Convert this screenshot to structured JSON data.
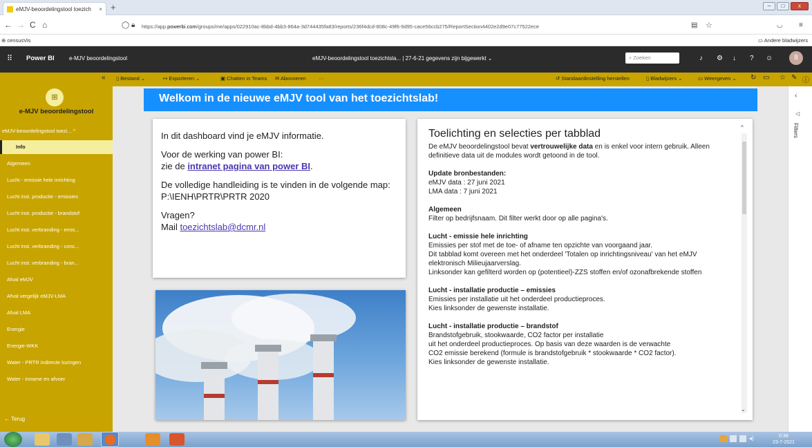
{
  "browser": {
    "tab_title": "eMJV-beoordelingstool toezich",
    "tab_close": "×",
    "new_tab": "+",
    "url_prefix": "https://app.",
    "url_domain": "powerbi.com",
    "url_rest": "/groups/me/apps/022910ac-8bbd-4bb3-864a-3d744435fa83/reports/236f4dcd-808c-49f6-9d95-cace56ccb275/ReportSection4402e2d9e07c77522ece",
    "bookmark": "censusVis",
    "other_bookmarks": "Andere bladwijzers"
  },
  "pbi": {
    "app_label": "Power BI",
    "app_name": "e-MJV beoordelingstool",
    "report_title": "eMJV-beoordelingstool toezichtsla...  |  27-6-21 gegevens zijn bijgewerkt",
    "search_placeholder": "Zoeken",
    "avatar_letter": "8"
  },
  "toolbar": {
    "file": "Bestand",
    "export": "Exporteren",
    "chat": "Chatten in Teams",
    "subscribe": "Abonneren",
    "more": "···",
    "reset": "Standaardinstelling herstellen",
    "bookmarks": "Bladwijzers",
    "view": "Weergeven"
  },
  "sidebar": {
    "app_title": "e-MJV beoordelingstool",
    "section": "eMJV-beoordelingstool toezi...",
    "back": "Terug",
    "items": [
      {
        "label": "Info",
        "selected": true
      },
      {
        "label": "Algemeen"
      },
      {
        "label": "Lucht - emissie hele inrichting"
      },
      {
        "label": "Lucht inst. productie - emissies"
      },
      {
        "label": "Lucht inst. productie - brandstof"
      },
      {
        "label": "Lucht inst. verbranding - emis..."
      },
      {
        "label": "Lucht inst. verbranding - conc..."
      },
      {
        "label": "Lucht inst. verbranding - bran..."
      },
      {
        "label": "Afval eMJV"
      },
      {
        "label": "Afval vergelijk eMJV-LMA"
      },
      {
        "label": "Afval LMA"
      },
      {
        "label": "Energie"
      },
      {
        "label": "Energie-WKK"
      },
      {
        "label": "Water - PRTR indirecte lozingen"
      },
      {
        "label": "Water - inname en afvoer"
      }
    ]
  },
  "report": {
    "banner": "Welkom in de nieuwe eMJV tool van het toezichtslab!",
    "info_intro": "In dit dashboard vind je eMJV informatie.",
    "info_power1": "Voor de werking van power BI:",
    "info_power2_pre": "zie de ",
    "info_power2_link": "intranet pagina van power BI",
    "info_power2_post": ".",
    "info_manual": "De volledige handleiding is te vinden in de volgende map: P:\\IENH\\PRTR\\PRTR 2020",
    "info_q": "Vragen?",
    "info_mail_pre": "Mail ",
    "info_mail_link": "toezichtslab@dcmr.nl",
    "right_title": "Toelichting en selecties per tabblad",
    "right_intro_pre": "De eMJV beoordelingstool bevat ",
    "right_intro_bold": "vertrouwelijke data",
    "right_intro_post": " en is enkel voor intern gebruik. Alleen definitieve data uit de modules wordt getoond in de tool.",
    "sections": [
      {
        "title": "Update bronbestanden:",
        "lines": [
          "eMJV data : 27 juni 2021",
          "LMA data  : 7 juni 2021"
        ]
      },
      {
        "title": "Algemeen",
        "lines": [
          "Filter op bedrijfsnaam. Dit filter werkt door op alle pagina's."
        ]
      },
      {
        "title": "Lucht - emissie hele inrichting",
        "lines": [
          "Emissies per stof met de toe- of afname ten opzichte van voorgaand jaar.",
          "Dit tabblad komt overeen met het onderdeel 'Totalen op inrichtingsniveau' van het eMJV elektronisch Milieujaarverslag.",
          "Linksonder kan gefilterd worden op (potentieel)-ZZS stoffen en/of ozonafbrekende stoffen"
        ]
      },
      {
        "title": "Lucht - installatie productie – emissies",
        "lines": [
          "Emissies per installatie uit het onderdeel productieproces.",
          "Kies linksonder de gewenste installatie."
        ]
      },
      {
        "title": "Lucht - installatie productie – brandstof",
        "lines": [
          "Brandstofgebruik, stookwaarde, CO2 factor per installatie",
          "uit het onderdeel productieproces. Op basis van deze waarden is de verwachte",
          "CO2 emissie berekend (formule is brandstofgebruik * stookwaarde * CO2 factor).",
          "Kies linksonder de gewenste installatie."
        ]
      }
    ]
  },
  "filters_label": "Filters",
  "taskbar": {
    "time": "0:38",
    "date": "23-7-2021"
  },
  "colors": {
    "accent": "#c8a400",
    "banner": "#168fff",
    "selected": "#f6ee9f",
    "header": "#2b2b2b"
  }
}
